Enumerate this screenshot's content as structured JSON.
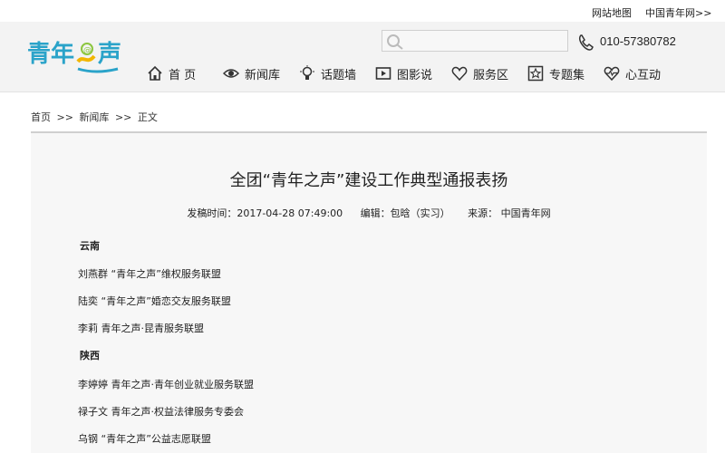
{
  "topbar": {
    "sitemap": "网站地图",
    "cyol": "中国青年网>>"
  },
  "header": {
    "logo_text": "青年之声",
    "search": {
      "placeholder": "",
      "value": ""
    },
    "phone": "010-57380782",
    "nav": [
      {
        "label": "首 页",
        "icon": "home-icon"
      },
      {
        "label": "新闻库",
        "icon": "eye-icon"
      },
      {
        "label": "话题墙",
        "icon": "bulb-icon"
      },
      {
        "label": "图影说",
        "icon": "film-icon"
      },
      {
        "label": "服务区",
        "icon": "heart-outline-icon"
      },
      {
        "label": "专题集",
        "icon": "star-box-icon"
      },
      {
        "label": "心互动",
        "icon": "heartbeat-icon"
      }
    ]
  },
  "breadcrumb": [
    "首页",
    "新闻库",
    "正文"
  ],
  "breadcrumb_sep": ">>",
  "article": {
    "title": "全团“青年之声”建设工作典型通报表扬",
    "meta": {
      "time": "发稿时间：2017-04-28 07:49:00",
      "editor": "编辑：包晗（实习）",
      "source": "来源：  中国青年网"
    },
    "lines": [
      {
        "text": "云南",
        "bold": true
      },
      {
        "text": "刘燕群 “青年之声”维权服务联盟",
        "bold": false
      },
      {
        "text": "陆奕 “青年之声”婚恋交友服务联盟",
        "bold": false
      },
      {
        "text": "李莉 青年之声·昆青服务联盟",
        "bold": false
      },
      {
        "text": "陕西",
        "bold": true
      },
      {
        "text": "李婷婷 青年之声·青年创业就业服务联盟",
        "bold": false
      },
      {
        "text": "禄子文 青年之声·权益法律服务专委会",
        "bold": false
      },
      {
        "text": "乌钢 “青年之声”公益志愿联盟",
        "bold": false
      }
    ]
  },
  "colors": {
    "logo_blue": "#2aa3c9",
    "logo_green": "#8cc63f",
    "logo_yellow": "#f2b600"
  }
}
